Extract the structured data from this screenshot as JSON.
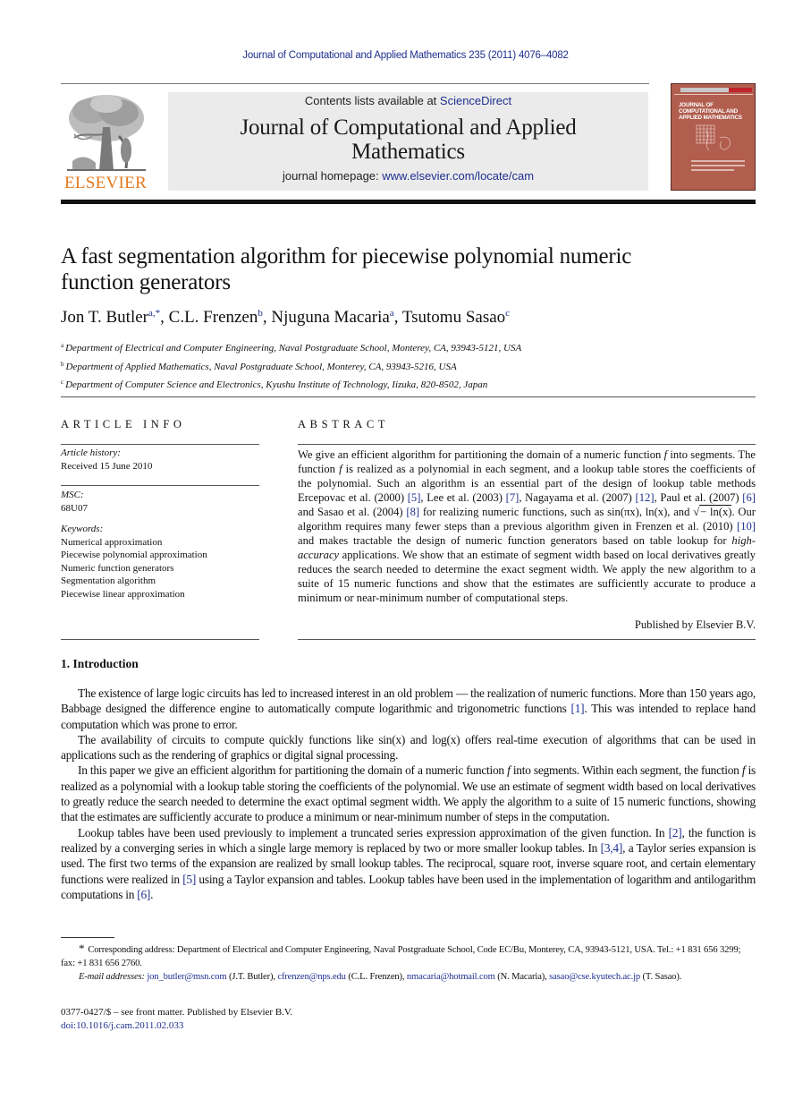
{
  "header": {
    "citation": "Journal of Computational and Applied Mathematics 235 (2011) 4076–4082",
    "contents_prefix": "Contents lists available at ",
    "contents_link": "ScienceDirect",
    "journal_name_line1": "Journal of Computational and Applied",
    "journal_name_line2": "Mathematics",
    "homepage_prefix": "journal homepage: ",
    "homepage_link": "www.elsevier.com/locate/cam",
    "publisher_logo_text": "ELSEVIER",
    "cover": {
      "title_line1": "JOURNAL OF",
      "title_line2": "COMPUTATIONAL AND",
      "title_line3": "APPLIED MATHEMATICS",
      "color": "#b15e4f"
    }
  },
  "article": {
    "title_line1": "A fast segmentation algorithm for piecewise polynomial numeric",
    "title_line2": "function generators",
    "authors": [
      {
        "name": "Jon T. Butler",
        "sup": "a,*"
      },
      {
        "name": "C.L. Frenzen",
        "sup": "b"
      },
      {
        "name": "Njuguna Macaria",
        "sup": "a"
      },
      {
        "name": "Tsutomu Sasao",
        "sup": "c"
      }
    ],
    "affiliations": [
      {
        "key": "a",
        "text": "Department of Electrical and Computer Engineering, Naval Postgraduate School, Monterey, CA, 93943-5121, USA"
      },
      {
        "key": "b",
        "text": "Department of Applied Mathematics, Naval Postgraduate School, Monterey, CA, 93943-5216, USA"
      },
      {
        "key": "c",
        "text": "Department of Computer Science and Electronics, Kyushu Institute of Technology, Iizuka, 820-8502, Japan"
      }
    ]
  },
  "article_info": {
    "label": "ARTICLE INFO",
    "history_label": "Article history:",
    "received": "Received 15 June 2010",
    "msc_label": "MSC:",
    "msc": "68U07",
    "keywords_label": "Keywords:",
    "keywords": [
      "Numerical approximation",
      "Piecewise polynomial approximation",
      "Numeric function generators",
      "Segmentation algorithm",
      "Piecewise linear approximation"
    ]
  },
  "abstract": {
    "label": "ABSTRACT",
    "t1": "We give an efficient algorithm for partitioning the domain of a numeric function ",
    "f": "f",
    "t2": " into segments. The function ",
    "t3": " is realized as a polynomial in each segment, and a lookup table stores the coefficients of the polynomial. Such an algorithm is an essential part of the design of lookup table methods Ercepovac et al. (2000) ",
    "r5": "[5]",
    "t4": ", Lee et al. (2003) ",
    "r7": "[7]",
    "t5": ", Nagayama et al. (2007) ",
    "r12": "[12]",
    "t6": ", Paul et al. (2007) ",
    "r6": "[6]",
    "t7": " and Sasao et al. (2004) ",
    "r8": "[8]",
    "t8": " for realizing numeric functions, such as sin(πx), ln(x), and ",
    "sqrt_sym": "√",
    "sqrt_arg": "− ln(x)",
    "t9": ". Our algorithm requires many fewer steps than a previous algorithm given in Frenzen et al. (2010) ",
    "r10": "[10]",
    "t10": " and makes tractable the design of numeric function generators based on table lookup for ",
    "hi_acc": "high-accuracy",
    "t11": " applications. We show that an estimate of segment width based on local derivatives greatly reduces the search needed to determine the exact segment width. We apply the new algorithm to a suite of 15 numeric functions and show that the estimates are sufficiently accurate to produce a minimum or near-minimum number of computational steps.",
    "published_by": "Published by Elsevier B.V."
  },
  "introduction": {
    "heading": "1.  Introduction",
    "p1a": "The existence of large logic circuits has led to increased interest in an old problem — the realization of numeric functions. More than 150 years ago, Babbage designed the difference engine to automatically compute logarithmic and trigonometric functions ",
    "p1ref": "[1]",
    "p1b": ". This was intended to replace hand computation which was prone to error.",
    "p2": "The availability of circuits to compute quickly functions like sin(x) and log(x) offers real-time execution of algorithms that can be used in applications such as the rendering of graphics or digital signal processing.",
    "p3a": "In this paper we give an efficient algorithm for partitioning the domain of a numeric function ",
    "p3b": " into segments. Within each segment, the function ",
    "p3c": " is realized as a polynomial with a lookup table storing the coefficients of the polynomial. We use an estimate of segment width based on local derivatives to greatly reduce the search needed to determine the exact optimal segment width. We apply the algorithm to a suite of 15 numeric functions, showing that the estimates are sufficiently accurate to produce a minimum or near-minimum number of steps in the computation.",
    "p4a": "Lookup tables have been used previously to implement a truncated series expression approximation of the given function. In ",
    "p4r2": "[2]",
    "p4b": ", the function is realized by a converging series in which a single large memory is replaced by two or more smaller lookup tables. In ",
    "p4r34": "[3,4]",
    "p4c": ", a Taylor series expansion is used. The first two terms of the expansion are realized by small lookup tables. The reciprocal, square root, inverse square root, and certain elementary functions were realized in ",
    "p4r5": "[5]",
    "p4d": " using a Taylor expansion and tables. Lookup tables have been used in the implementation of logarithm and antilogarithm computations in ",
    "p4r6": "[6]",
    "p4e": "."
  },
  "footnotes": {
    "star": "*",
    "corresponding": "Corresponding address: Department of Electrical and Computer Engineering, Naval Postgraduate School, Code EC/Bu, Monterey, CA, 93943-5121, USA. Tel.: +1 831 656 3299; fax: +1 831 656 2760.",
    "email_label": "E-mail addresses:",
    "emails": [
      {
        "address": "jon_butler@msn.com",
        "who": " (J.T. Butler), "
      },
      {
        "address": "cfrenzen@nps.edu",
        "who": " (C.L. Frenzen), "
      },
      {
        "address": "nmacaria@hotmail.com",
        "who": " (N. Macaria), "
      },
      {
        "address": "sasao@cse.kyutech.ac.jp",
        "who": " (T. Sasao)."
      }
    ],
    "issn": "0377-0427/$ – see front matter.  Published by Elsevier B.V.",
    "doi": "doi:10.1016/j.cam.2011.02.033"
  },
  "colors": {
    "link": "#1f2f8f",
    "elsevier_orange": "#e67a1e",
    "banner_gray": "#ebebeb"
  }
}
